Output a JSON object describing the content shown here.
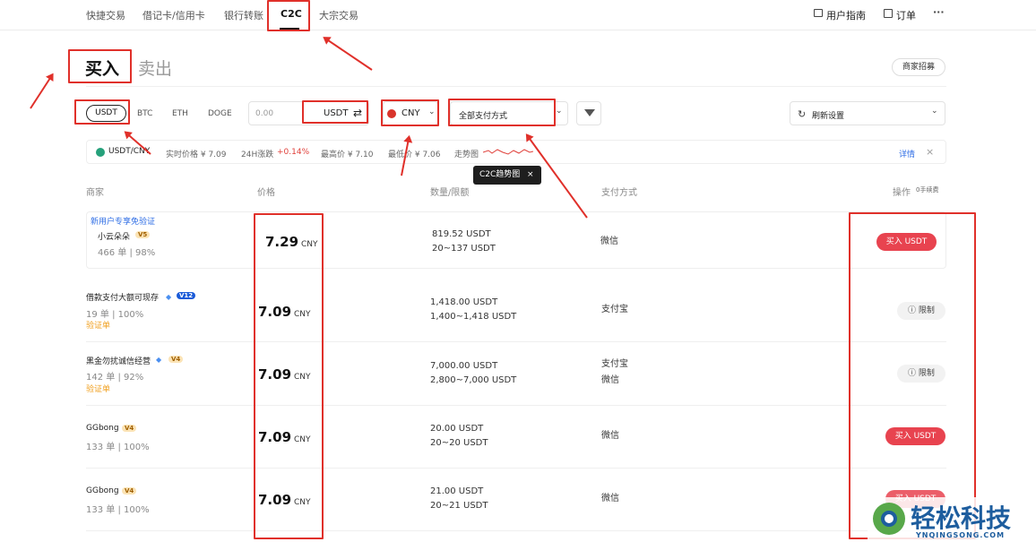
{
  "nav": {
    "items": [
      "快捷交易",
      "借记卡/信用卡",
      "银行转账",
      "C2C",
      "大宗交易"
    ],
    "guide": "用户指南",
    "orders": "订单",
    "more": "···"
  },
  "tabs": {
    "buy": "买入",
    "sell": "卖出"
  },
  "recruit_btn": "商家招募",
  "coins": [
    "USDT",
    "BTC",
    "ETH",
    "DOGE"
  ],
  "amount_placeholder": "0.00",
  "amount_unit": "USDT",
  "swap_icon": "⇄",
  "currency": "CNY",
  "payment_select": "全部支付方式",
  "refresh_select": "刷新设置",
  "ticker": {
    "pair": "USDT/CNY",
    "realtime": "实时价格 ¥ 7.09",
    "change_label": "24H涨跌",
    "change_value": "+0.14%",
    "high": "最高价 ¥ 7.10",
    "low": "最低价 ¥ 7.06",
    "trend_label": "走势图",
    "details": "详情",
    "close": "×",
    "tooltip": "C2C趋势图",
    "tooltip_close": "×"
  },
  "table": {
    "headers": {
      "merchant": "商家",
      "price": "价格",
      "qty": "数量/限额",
      "pay": "支付方式",
      "op": "操作",
      "fee": "0手续费"
    }
  },
  "rows": [
    {
      "promo": "新用户专享免验证",
      "name": "小云朵朵",
      "badge": "V5",
      "stats": "466 单 | 98%",
      "price": "7.29",
      "unit": "CNY",
      "qty": "819.52 USDT",
      "limit": "20~137 USDT",
      "pay1": "微信",
      "pay2": "",
      "action": "买入 USDT",
      "verify": ""
    },
    {
      "promo": "",
      "name": "借款支付大额可现存",
      "badge": "V12",
      "stats": "19 单 | 100%",
      "price": "7.09",
      "unit": "CNY",
      "qty": "1,418.00 USDT",
      "limit": "1,400~1,418 USDT",
      "pay1": "支付宝",
      "pay2": "",
      "action": "限制",
      "verify": "验证单"
    },
    {
      "promo": "",
      "name": "黑金勿扰诚信经营",
      "badge": "V4",
      "stats": "142 单 | 92%",
      "price": "7.09",
      "unit": "CNY",
      "qty": "7,000.00 USDT",
      "limit": "2,800~7,000 USDT",
      "pay1": "支付宝",
      "pay2": "微信",
      "action": "限制",
      "verify": "验证单"
    },
    {
      "promo": "",
      "name": "GGbong",
      "badge": "V4",
      "stats": "133 单 | 100%",
      "price": "7.09",
      "unit": "CNY",
      "qty": "20.00 USDT",
      "limit": "20~20 USDT",
      "pay1": "微信",
      "pay2": "",
      "action": "买入 USDT",
      "verify": ""
    },
    {
      "promo": "",
      "name": "GGbong",
      "badge": "V4",
      "stats": "133 单 | 100%",
      "price": "7.09",
      "unit": "CNY",
      "qty": "21.00 USDT",
      "limit": "20~21 USDT",
      "pay1": "微信",
      "pay2": "",
      "action": "买入 USDT",
      "verify": ""
    }
  ],
  "watermark": {
    "brand": "轻松科技",
    "url": "YNQINGSONG.COM"
  }
}
